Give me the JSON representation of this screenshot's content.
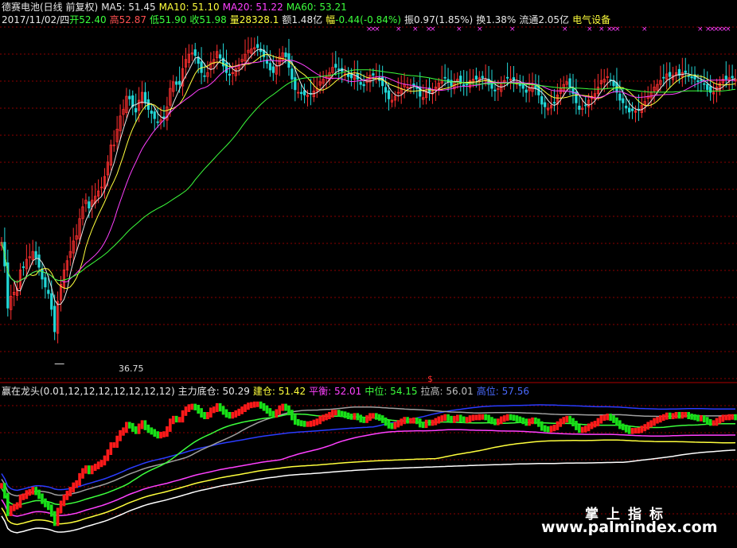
{
  "header": {
    "stock_title": "德赛电池(日线 前复权)",
    "ma5": "MA5: 51.45",
    "ma10": "MA10: 51.10",
    "ma20": "MA20: 51.22",
    "ma60": "MA60: 53.21",
    "date": "2017/11/02/四",
    "open_label": "开",
    "open": "52.40",
    "high_label": "高",
    "high": "52.87",
    "low_label": "低",
    "low": "51.90",
    "close_label": "收",
    "close": "51.98",
    "volume_label": "量",
    "volume": "28328.1",
    "amount": "额1.48亿",
    "change_label": "幅",
    "change": "-0.44(-0.84%)",
    "amplitude": "振0.97(1.85%)",
    "turnover": "换1.38%",
    "float_cap": "流通2.05亿",
    "sector": "电气设备"
  },
  "indicator": {
    "name": "赢在龙头(0.01,12,12,12,12,12,12,12)",
    "main_bottom": "主力底仓: 50.29",
    "build": "建仓: 51.42",
    "balance": "平衡: 52.01",
    "middle": "中位: 54.15",
    "pull_up": "拉高: 56.01",
    "high_pos": "高位: 57.56"
  },
  "annotations": {
    "low_price": "36.75",
    "marker": "$",
    "x_mark": "×"
  },
  "watermark": {
    "line1": "掌上指标",
    "line2": "www.palmindex.com"
  },
  "colors": {
    "up": "#ff3030",
    "down": "#22d8d8",
    "ma5": "#e8e8e8",
    "ma10": "#ffff3c",
    "ma20": "#ff40ff",
    "ma60": "#3cff3c",
    "grid": "#8b0000",
    "high_pos_line": "#2a3cff",
    "pull_up_line": "#a0a0a0",
    "middle_line": "#3cff3c",
    "balance_line": "#ff40ff",
    "build_line": "#ffff3c",
    "bottom_line": "#ffffff"
  },
  "chart_data": {
    "type": "candlestick",
    "price_range": [
      36.0,
      62.0
    ],
    "low_marker": 36.75,
    "closes": [
      46.0,
      44.2,
      41.0,
      41.9,
      42.2,
      42.5,
      43.9,
      44.1,
      44.7,
      44.9,
      45.3,
      44.8,
      44.1,
      43.2,
      42.6,
      42.1,
      40.9,
      39.2,
      41.5,
      42.8,
      43.9,
      44.6,
      45.3,
      46.1,
      46.5,
      47.8,
      48.7,
      49.2,
      48.6,
      49.2,
      49.5,
      49.9,
      50.2,
      51.0,
      52.1,
      53.4,
      53.4,
      54.6,
      55.6,
      56.1,
      57.1,
      56.9,
      56.3,
      55.9,
      56.8,
      57.4,
      56.6,
      56.1,
      55.8,
      55.4,
      55.1,
      55.3,
      55.4,
      56.3,
      57.7,
      58.2,
      58.0,
      58.0,
      59.2,
      59.9,
      60.3,
      60.4,
      60.2,
      59.6,
      58.9,
      58.6,
      58.9,
      59.7,
      59.9,
      60.5,
      60.0,
      59.4,
      58.9,
      58.7,
      58.9,
      59.2,
      59.5,
      59.9,
      60.3,
      60.6,
      60.7,
      60.8,
      60.8,
      60.5,
      60.1,
      59.6,
      59.1,
      58.9,
      59.4,
      60.1,
      60.4,
      60.1,
      59.3,
      58.4,
      57.6,
      57.4,
      57.3,
      57.2,
      57.2,
      57.3,
      57.5,
      57.7,
      58.2,
      58.4,
      58.6,
      58.9,
      59.3,
      59.3,
      59.1,
      59.0,
      58.8,
      58.6,
      58.5,
      58.7,
      58.4,
      58.0,
      57.9,
      58.3,
      58.7,
      58.7,
      58.5,
      58.3,
      57.9,
      57.4,
      56.9,
      56.8,
      57.1,
      57.4,
      57.7,
      58.0,
      57.8,
      57.8,
      57.9,
      57.7,
      57.1,
      57.0,
      57.5,
      57.4,
      57.5,
      57.8,
      58.1,
      58.3,
      58.5,
      58.2,
      57.9,
      58.2,
      58.4,
      58.1,
      57.9,
      58.0,
      58.3,
      58.4,
      58.4,
      58.5,
      58.5,
      58.4,
      58.0,
      57.7,
      57.5,
      57.7,
      58.1,
      58.3,
      58.5,
      58.4,
      58.3,
      58.1,
      57.9,
      57.7,
      57.4,
      57.7,
      57.9,
      57.7,
      57.2,
      56.5,
      56.3,
      56.2,
      56.4,
      56.6,
      57.2,
      57.7,
      58.0,
      58.2,
      57.8,
      57.3,
      56.6,
      56.1,
      56.2,
      56.4,
      56.8,
      57.1,
      57.3,
      57.8,
      58.3,
      58.4,
      58.6,
      58.3,
      57.9,
      57.4,
      56.8,
      56.6,
      56.2,
      55.9,
      56.0,
      56.0,
      56.1,
      56.4,
      56.7,
      57.1,
      57.4,
      57.8,
      58.0,
      58.3,
      58.5,
      58.8,
      58.6,
      58.7,
      58.9,
      58.7,
      58.9,
      58.9,
      58.6,
      58.5,
      58.4,
      58.2,
      58.3,
      58.0,
      57.6,
      57.4,
      57.4,
      57.8,
      58.1,
      58.4,
      58.4,
      58.5,
      58.5,
      58.4
    ]
  }
}
